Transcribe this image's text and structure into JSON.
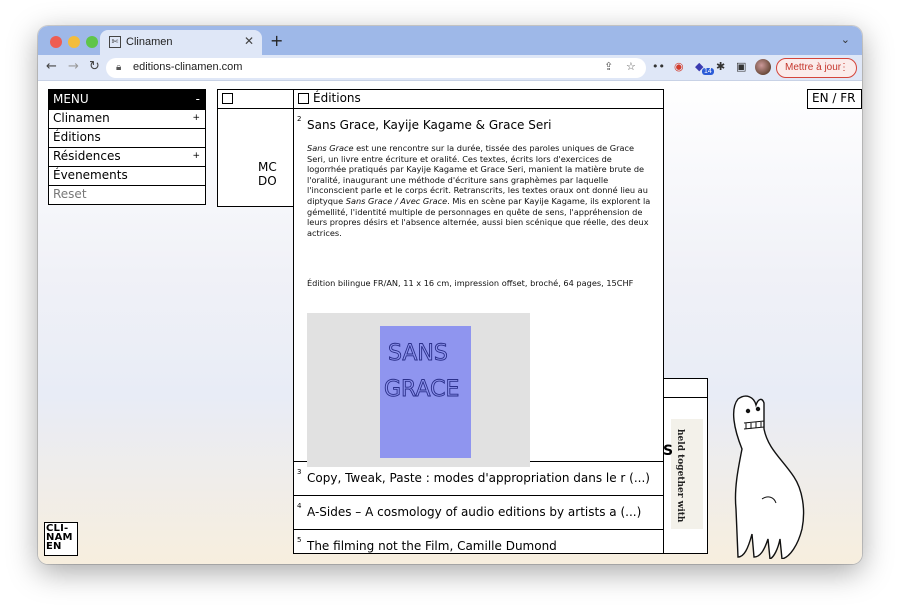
{
  "browser": {
    "tab_favicon": "✄",
    "tab_title": "Clinamen",
    "url": "editions-clinamen.com",
    "extension_badge": "14",
    "update_button": "Mettre à jour",
    "icons": [
      "back-icon",
      "forward-icon",
      "reload-icon",
      "lock-icon",
      "share-icon",
      "bookmark-star-icon",
      "extensions-puzzle-icon",
      "sidebar-icon",
      "more-icon"
    ]
  },
  "menu": {
    "title": "MENU",
    "minimize": "-",
    "items": [
      {
        "label": "Clinamen",
        "expand": "+"
      },
      {
        "label": "Éditions",
        "expand": ""
      },
      {
        "label": "Résidences",
        "expand": "+"
      },
      {
        "label": "Évenements",
        "expand": ""
      },
      {
        "label": "Reset",
        "expand": ""
      }
    ]
  },
  "background_window": {
    "text": "MC DO"
  },
  "lang": "EN / FR",
  "logo": {
    "line1": "CLI-",
    "line2": "NAM",
    "line3": "EN"
  },
  "editions": {
    "title": "Éditions",
    "entries": [
      {
        "number": "2",
        "title": "Sans Grace, Kayije Kagame & Grace Seri",
        "desc_em1": "Sans Grace",
        "desc_part1": " est une rencontre sur la durée, tissée des paroles uniques de Grace Seri, un livre entre écriture et oralité. Ces textes, écrits lors d'exercices de logorrhée pratiqués par Kayije Kagame et Grace Seri, manient la matière brute de l'oralité, inaugurant une méthode d'écriture sans graphèmes par laquelle l'inconscient parle et le corps écrit. Retranscrits, les textes oraux ont donné lieu au diptyque ",
        "desc_em2": "Sans Grace / Avec Grace",
        "desc_part2": ". Mis en scène par Kayije Kagame, ils explorent la gémellité, l'identité multiple de personnages en quête de sens, l'appréhension de leurs propres désirs et l'absence alternée, aussi bien scénique que réelle, des deux actrices.",
        "spec": "Édition bilingue FR/AN, 11 x 16 cm, impression offset, broché, 64 pages, 15CHF",
        "cover_text_1": "SANS",
        "cover_text_2": "GRACE"
      },
      {
        "number": "3",
        "title": "Copy, Tweak, Paste : modes d'appropriation dans le r (...)"
      },
      {
        "number": "4",
        "title": "A-Sides – A cosmology of audio editions by artists a (...)"
      },
      {
        "number": "5",
        "title": "The filming not the Film, Camille Dumond"
      }
    ]
  },
  "right_window": {
    "book_spine": "held together with",
    "letter": "S"
  },
  "colors": {
    "cover": "#8f95ef",
    "cover_bg": "#e1e1e1",
    "tab_strip": "#9eb8e8",
    "update": "#c5372d"
  }
}
